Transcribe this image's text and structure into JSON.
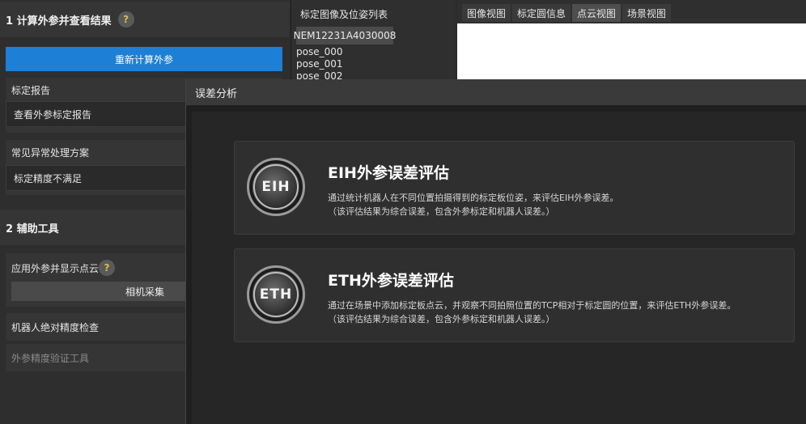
{
  "left": {
    "section1": {
      "title": "1 计算外参并查看结果",
      "help": "?"
    },
    "recompute_button": "重新计算外参",
    "report": {
      "label": "标定报告",
      "view": "查看外参标定报告"
    },
    "faq": {
      "label": "常见异常处理方案",
      "item": "标定精度不满足"
    },
    "section2": {
      "title": "2 辅助工具"
    },
    "apply": {
      "label": "应用外参并显示点云",
      "help": "?",
      "button": "相机采集"
    },
    "robot_check": "机器人绝对精度检查",
    "ext_tool": "外参精度验证工具"
  },
  "list": {
    "title": "标定图像及位姿列表",
    "tab": "NEM12231A4030008",
    "poses": [
      "pose_000",
      "pose_001",
      "pose_002"
    ]
  },
  "viewer": {
    "tabs": [
      "图像视图",
      "标定圆信息",
      "点云视图",
      "场景视图"
    ],
    "active_tab": 2
  },
  "modal": {
    "title": "误差分析",
    "cards": [
      {
        "badge": "EIH",
        "title": "EIH外参误差评估",
        "desc1": "通过统计机器人在不同位置拍摄得到的标定板位姿，来评估EIH外参误差。",
        "desc2": "（该评估结果为综合误差，包含外参标定和机器人误差。）"
      },
      {
        "badge": "ETH",
        "title": "ETH外参误差评估",
        "desc1": "通过在场景中添加标定板点云，并观察不同拍照位置的TCP相对于标定圆的位置，来评估ETH外参误差。",
        "desc2": "（该评估结果为综合误差，包含外参标定和机器人误差。）"
      }
    ]
  }
}
